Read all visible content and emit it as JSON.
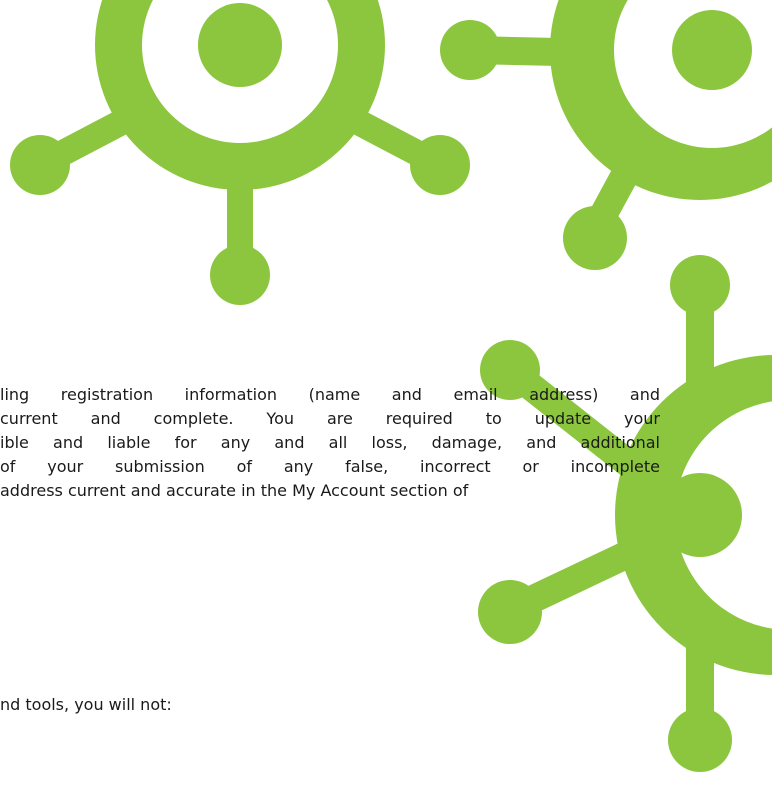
{
  "colors": {
    "accent_green": "#8cc63f",
    "text": "#1a1a1a",
    "background": "#ffffff"
  },
  "decoration": {
    "motif": "green molecule / hexagon network graphic"
  },
  "paragraph_1": {
    "lines": [
      "ling registration information (name and email address) and",
      "current and complete. You are required to update your",
      "ible and liable for any and all loss, damage, and additional",
      "of your submission of any false, incorrect or incomplete",
      "address current and accurate in the My Account section of"
    ]
  },
  "paragraph_2": {
    "text": "nd tools, you will not:"
  }
}
